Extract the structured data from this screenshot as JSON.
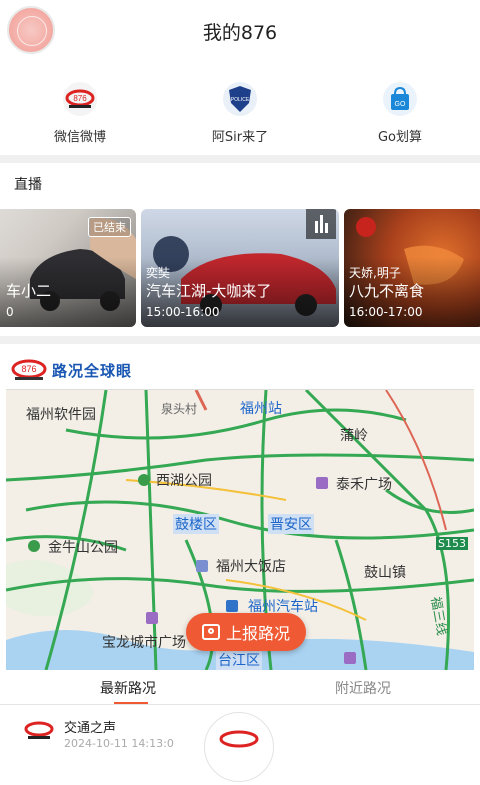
{
  "header": {
    "title": "我的876"
  },
  "quick_links": [
    {
      "label": "微信微博",
      "icon": "car-logo-icon"
    },
    {
      "label": "阿Sir来了",
      "icon": "police-badge-icon"
    },
    {
      "label": "Go划算",
      "icon": "shopping-bag-icon"
    }
  ],
  "live": {
    "section_title": "直播",
    "cards": [
      {
        "host": "",
        "name": "车小二",
        "time": "0",
        "badge": "已结束"
      },
      {
        "host": "奕奘",
        "name": "汽车江湖-大咖来了",
        "time": "15:00-16:00",
        "badge": ""
      },
      {
        "host": "天娇,明子",
        "name": "八九不离食",
        "time": "16:00-17:00",
        "badge": ""
      }
    ]
  },
  "traffic": {
    "banner_text": "路况全球眼",
    "map_labels": {
      "fuzhou_software_park": "福州软件园",
      "quanyi_village": "泉头村",
      "fuzhou_station": "福州站",
      "puling": "蒲岭",
      "west_lake_park": "西湖公园",
      "taihe_plaza": "泰禾广场",
      "gulou_district": "鼓楼区",
      "jinan_district": "晋安区",
      "s1531": "S153",
      "jinniushan_park": "金牛山公园",
      "fuzhou_hotel": "福州大饭店",
      "gushan_town": "鼓山镇",
      "fuzhou_bus_station": "福州汽车站",
      "baolong_plaza": "宝龙城市广场",
      "taijiang_district": "台江区",
      "ring_line": "福三线"
    },
    "report_button": "上报路况",
    "tabs": [
      "最新路况",
      "附近路况"
    ]
  },
  "feed": {
    "source": "交通之声",
    "meta": "2024-10-11 14:13:0"
  },
  "colors": {
    "accent": "#ef5a35",
    "brand_blue": "#1a57b3",
    "traffic_green": "#34a853"
  }
}
